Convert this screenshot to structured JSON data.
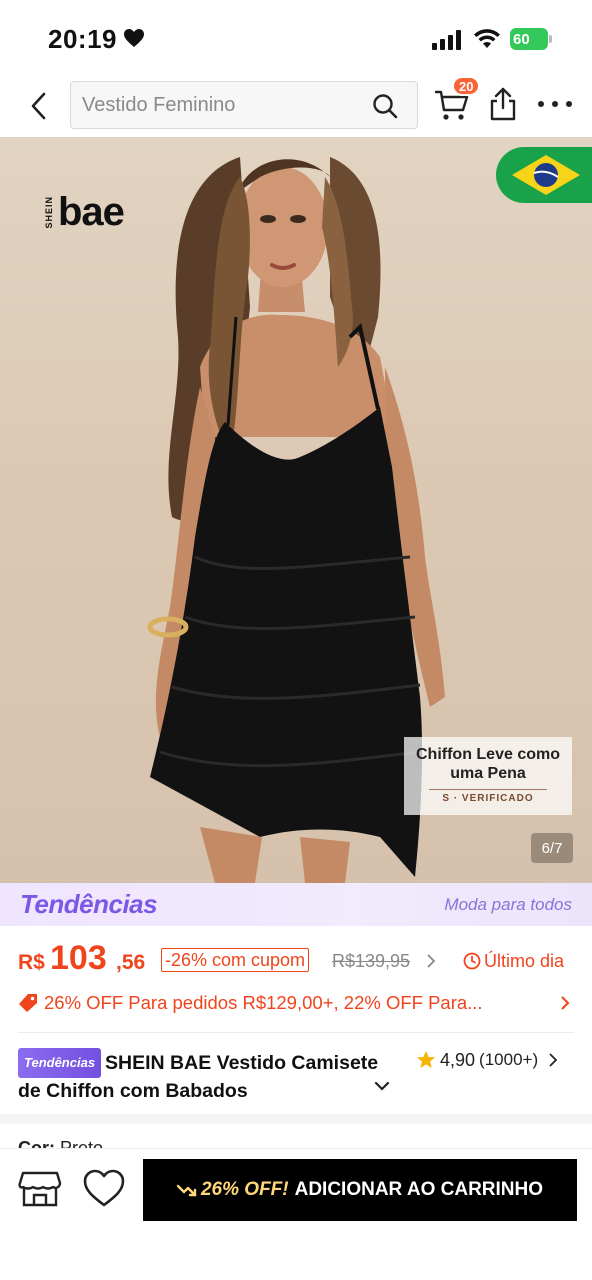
{
  "status": {
    "time": "20:19",
    "battery": "60"
  },
  "search": {
    "placeholder": "Vestido Feminino"
  },
  "header": {
    "cart_count": "20"
  },
  "hero": {
    "brand_small": "SHEIN",
    "brand": "bae",
    "callout_line1": "Chiffon Leve como",
    "callout_line2": "uma Pena",
    "callout_verified": "S · VERIFICADO",
    "counter": "6/7"
  },
  "trends": {
    "logo": "Tendências",
    "slogan": "Moda para todos"
  },
  "price": {
    "currency": "R$",
    "integer": "103",
    "decimal": ",56",
    "coupon": "-26% com cupom",
    "old_price": "R$139,95",
    "last_day": "Último dia"
  },
  "promo": {
    "text": "26% OFF Para pedidos R$129,00+,  22% OFF Para..."
  },
  "product": {
    "badge": "Tendências",
    "title": "SHEIN BAE Vestido Camisete de Chiffon com Babados",
    "rating": "4,90",
    "reviews": "(1000+)",
    "color_label": "Cor: ",
    "color_value": "Preto"
  },
  "bottom": {
    "off_label": "26% OFF!",
    "add_label": "ADICIONAR AO CARRINHO"
  },
  "colors": {
    "accent": "#f0441c",
    "badge": "#fa6338",
    "trends": "#7b58e6"
  }
}
